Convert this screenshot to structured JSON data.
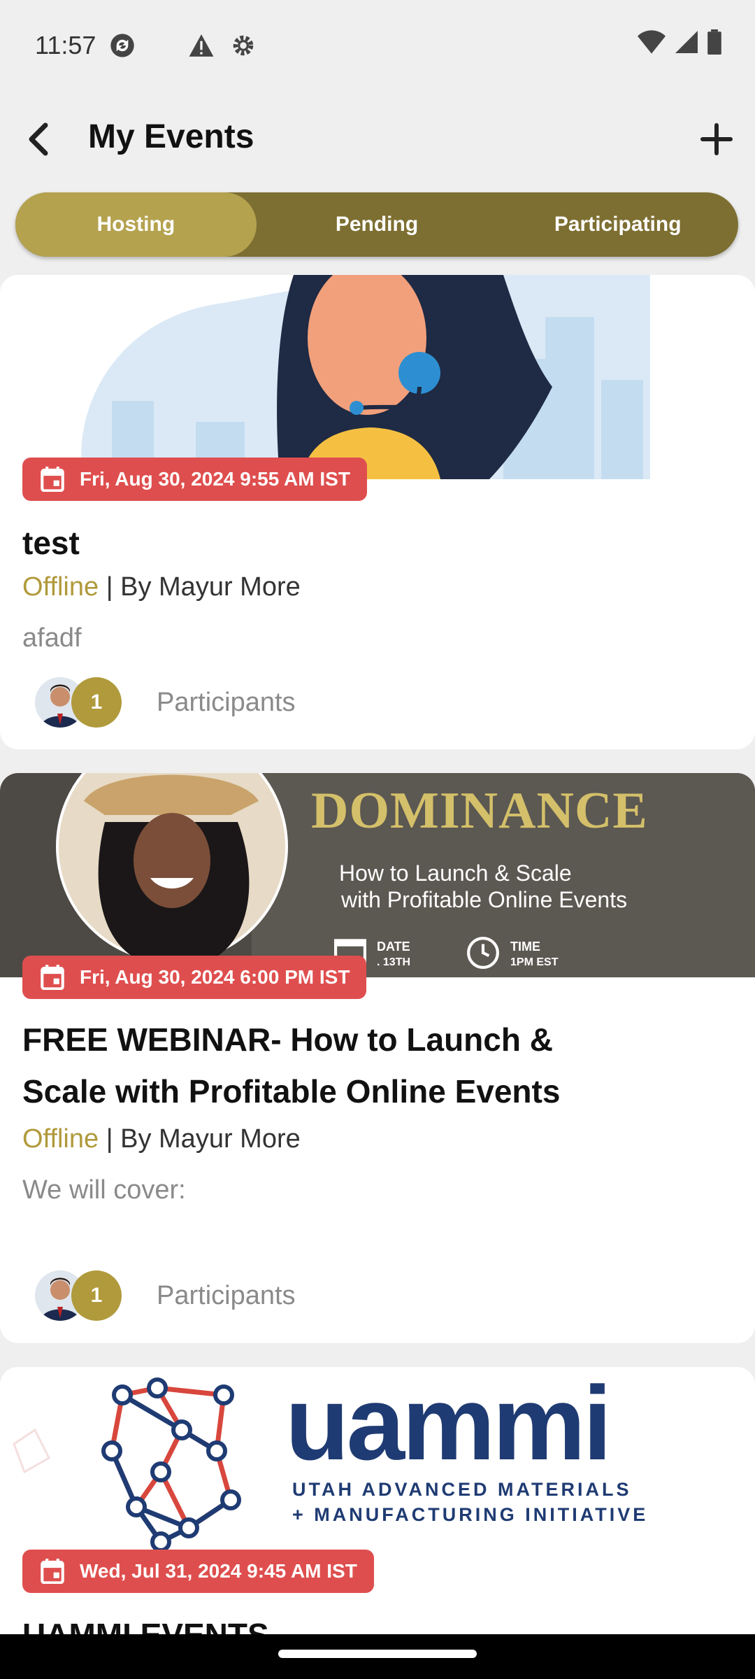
{
  "status_bar": {
    "time": "11:57"
  },
  "header": {
    "title": "My Events"
  },
  "tabs": [
    {
      "label": "Hosting",
      "active": true
    },
    {
      "label": "Pending",
      "active": false
    },
    {
      "label": "Participating",
      "active": false
    }
  ],
  "events": [
    {
      "datetime": "Fri, Aug 30, 2024 9:55 AM IST",
      "title": "test",
      "mode": "Offline",
      "by": " | By Mayur More",
      "description": "afadf",
      "participant_count": "1",
      "participants_label": "Participants"
    },
    {
      "banner": {
        "headline": "DOMINANCE",
        "line1": "How to Launch & Scale",
        "line2": "with Profitable Online Events",
        "date_label": "DATE",
        "date_value": ". 13TH",
        "time_label": "TIME",
        "time_value": "1PM EST"
      },
      "datetime": "Fri, Aug 30, 2024 6:00 PM IST",
      "title_line1": "FREE WEBINAR- How to Launch &",
      "title_line2": "Scale with Profitable Online Events",
      "mode": "Offline",
      "by": " | By Mayur More",
      "description": "We will cover:",
      "participant_count": "1",
      "participants_label": "Participants"
    },
    {
      "banner": {
        "logo_word": "uammi",
        "tag1": "UTAH ADVANCED MATERIALS",
        "tag2": "+ MANUFACTURING INITIATIVE"
      },
      "datetime": "Wed, Jul 31, 2024 9:45 AM IST",
      "title": "UAMMI EVENTS"
    }
  ],
  "colors": {
    "accent_gold": "#b09a3c",
    "tab_bg": "#7d6f32",
    "tab_active": "#b4a24f",
    "date_chip": "#df4e4e"
  },
  "icons": [
    "back-arrow-icon",
    "plus-icon",
    "calendar-icon",
    "sync-icon",
    "warning-icon",
    "settings-icon",
    "wifi-icon",
    "signal-icon",
    "battery-icon"
  ]
}
